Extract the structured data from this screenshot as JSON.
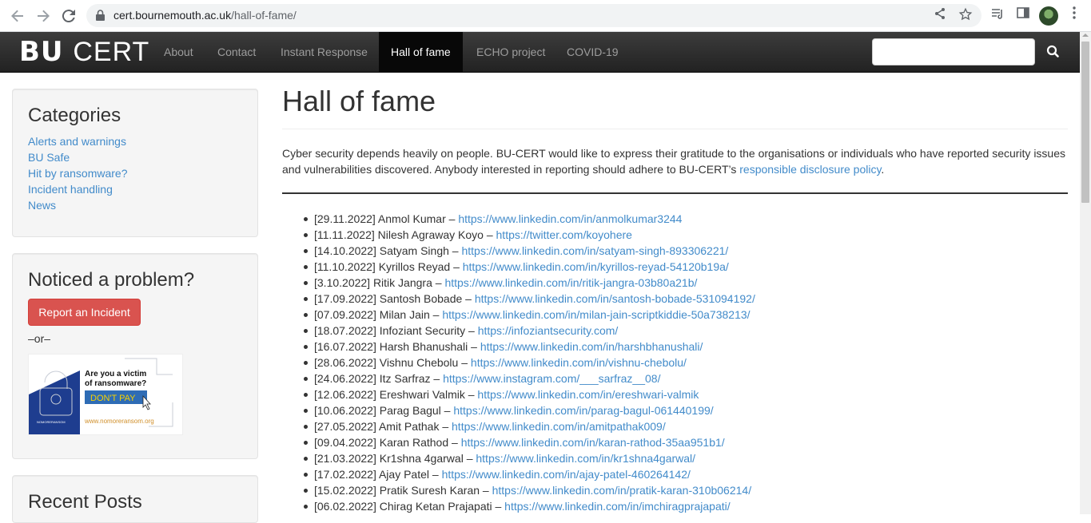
{
  "browser": {
    "url_host": "cert.bournemouth.ac.uk",
    "url_path": "/hall-of-fame/"
  },
  "site": {
    "logo_bu": "BU",
    "logo_cert": "CERT",
    "nav": [
      {
        "label": "About"
      },
      {
        "label": "Contact"
      },
      {
        "label": "Instant Response"
      },
      {
        "label": "Hall of fame"
      },
      {
        "label": "ECHO project"
      },
      {
        "label": "COVID-19"
      }
    ],
    "search_placeholder": ""
  },
  "sidebar": {
    "categories_title": "Categories",
    "categories": [
      {
        "label": "Alerts and warnings"
      },
      {
        "label": "BU Safe"
      },
      {
        "label": "Hit by ransomware?"
      },
      {
        "label": "Incident handling"
      },
      {
        "label": "News"
      }
    ],
    "problem_title": "Noticed a problem?",
    "report_label": "Report an Incident",
    "or_text": "–or–",
    "banner_line1": "Are you a victim",
    "banner_line2": "of ransomware?",
    "banner_button": "DON'T PAY",
    "banner_site": "www.nomoreransom.org",
    "banner_brand": "NOMORERANSOM",
    "recent_title": "Recent Posts"
  },
  "main": {
    "title": "Hall of fame",
    "intro_text": "Cyber security depends heavily on people. BU-CERT would like to express their gratitude to the organisations or individuals who have reported security issues and vulnerabilities discovered. Anybody interested in reporting should adhere to BU-CERT’s ",
    "intro_link": "responsible disclosure policy",
    "intro_end": ".",
    "entries": [
      {
        "text": "[29.11.2022] Anmol Kumar – ",
        "link": "https://www.linkedin.com/in/anmolkumar3244"
      },
      {
        "text": "[11.11.2022] Nilesh Agraway Koyo – ",
        "link": "https://twitter.com/koyohere"
      },
      {
        "text": "[14.10.2022] Satyam Singh – ",
        "link": "https://www.linkedin.com/in/satyam-singh-893306221/"
      },
      {
        "text": "[11.10.2022] Kyrillos Reyad – ",
        "link": "https://www.linkedin.com/in/kyrillos-reyad-54120b19a/"
      },
      {
        "text": "[3.10.2022] Ritik Jangra – ",
        "link": "https://www.linkedin.com/in/ritik-jangra-03b80a21b/"
      },
      {
        "text": "[17.09.2022] Santosh Bobade – ",
        "link": "https://www.linkedin.com/in/santosh-bobade-531094192/"
      },
      {
        "text": "[07.09.2022] Milan Jain – ",
        "link": "https://www.linkedin.com/in/milan-jain-scriptkiddie-50a738213/"
      },
      {
        "text": "[18.07.2022] Infoziant Security – ",
        "link": "https://infoziantsecurity.com/"
      },
      {
        "text": "[16.07.2022] Harsh Bhanushali – ",
        "link": "https://www.linkedin.com/in/harshbhanushali/"
      },
      {
        "text": "[28.06.2022] Vishnu Chebolu – ",
        "link": "https://www.linkedin.com/in/vishnu-chebolu/"
      },
      {
        "text": "[24.06.2022] Itz Sarfraz – ",
        "link": "https://www.instagram.com/___sarfraz__08/"
      },
      {
        "text": "[12.06.2022] Ereshwari Valmik – ",
        "link": "https://www.linkedin.com/in/ereshwari-valmik"
      },
      {
        "text": "[10.06.2022] Parag Bagul – ",
        "link": "https://www.linkedin.com/in/parag-bagul-061440199/"
      },
      {
        "text": "[27.05.2022] Amit Pathak – ",
        "link": "https://www.linkedin.com/in/amitpathak009/"
      },
      {
        "text": "[09.04.2022] Karan Rathod – ",
        "link": "https://www.linkedin.com/in/karan-rathod-35aa951b1/"
      },
      {
        "text": "[21.03.2022] Kr1shna 4garwal – ",
        "link": "https://www.linkedin.com/in/kr1shna4garwal/"
      },
      {
        "text": "[17.02.2022] Ajay Patel – ",
        "link": "https://www.linkedin.com/in/ajay-patel-460264142/"
      },
      {
        "text": "[15.02.2022] Pratik Suresh Karan – ",
        "link": "https://www.linkedin.com/in/pratik-karan-310b06214/"
      },
      {
        "text": "[06.02.2022] Chirag Ketan Prajapati – ",
        "link": "https://www.linkedin.com/in/imchiragprajapati/"
      }
    ]
  },
  "colors": {
    "link": "#428bca",
    "danger": "#d9534f",
    "navbar": "#222222"
  }
}
